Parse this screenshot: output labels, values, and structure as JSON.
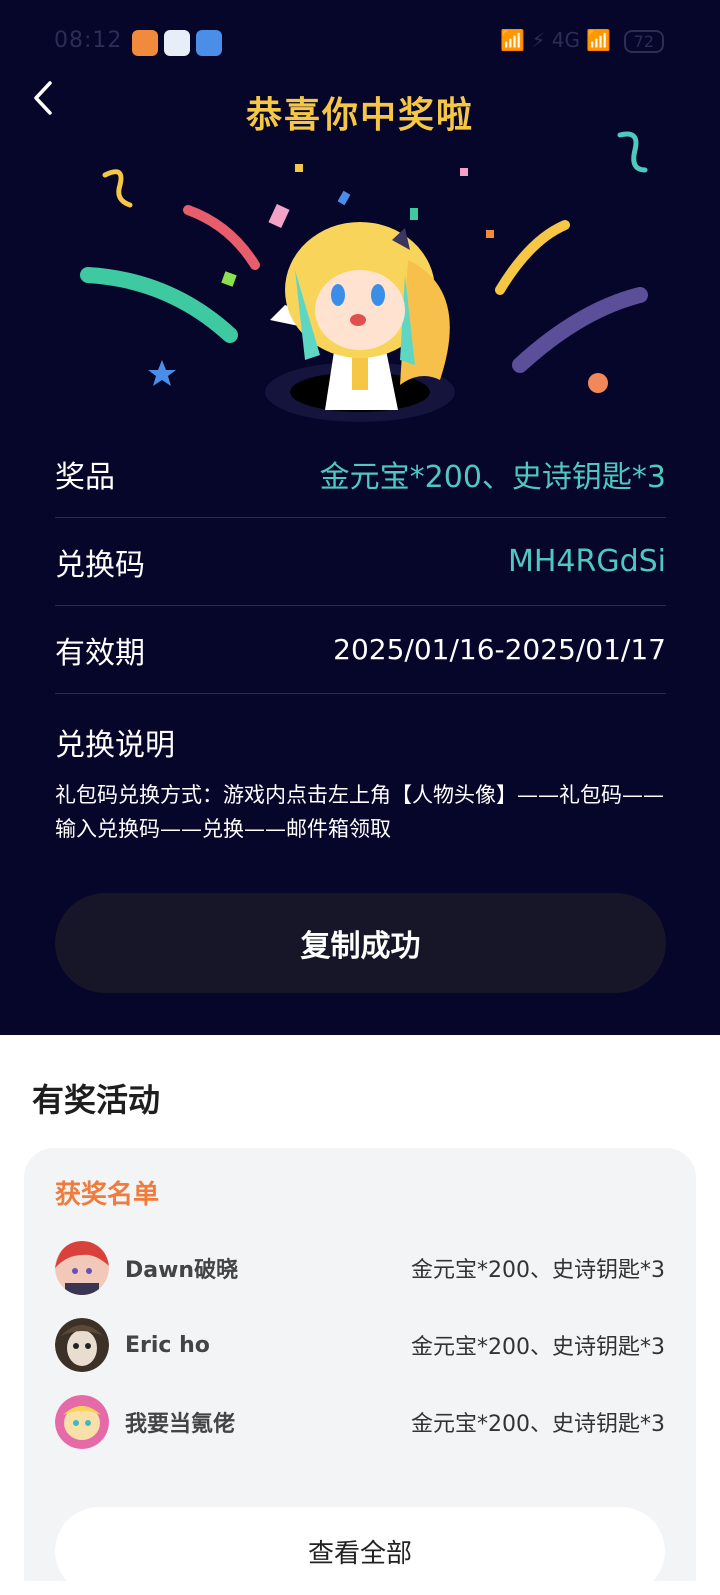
{
  "status_bar": {
    "time": "08:12",
    "right_text": "📶 ⚡ 4G 📶",
    "battery": "72"
  },
  "header": {
    "back_icon": "chevron-left-icon",
    "title": "恭喜你中奖啦"
  },
  "prize_info": {
    "rows": [
      {
        "label": "奖品",
        "value": "金元宝*200、史诗钥匙*3"
      },
      {
        "label": "兑换码",
        "value": "MH4RGdSi"
      },
      {
        "label": "有效期",
        "value": "2025/01/16-2025/01/17"
      }
    ],
    "instructions_title": "兑换说明",
    "instructions_text": "礼包码兑换方式：游戏内点击左上角【人物头像】——礼包码——输入兑换码——兑换——邮件箱领取"
  },
  "copy_button": {
    "label": "复制成功"
  },
  "activities": {
    "section_title": "有奖活动",
    "winners_title": "获奖名单",
    "winners": [
      {
        "name": "Dawn破晓",
        "prize": "金元宝*200、史诗钥匙*3"
      },
      {
        "name": "Eric ho",
        "prize": "金元宝*200、史诗钥匙*3"
      },
      {
        "name": "我要当氪佬",
        "prize": "金元宝*200、史诗钥匙*3"
      }
    ],
    "view_all_label": "查看全部"
  },
  "colors": {
    "background": "#06052a",
    "title_gold": "#f6c744",
    "value_teal": "#4fc9c0",
    "winners_orange": "#ef7b3c"
  }
}
